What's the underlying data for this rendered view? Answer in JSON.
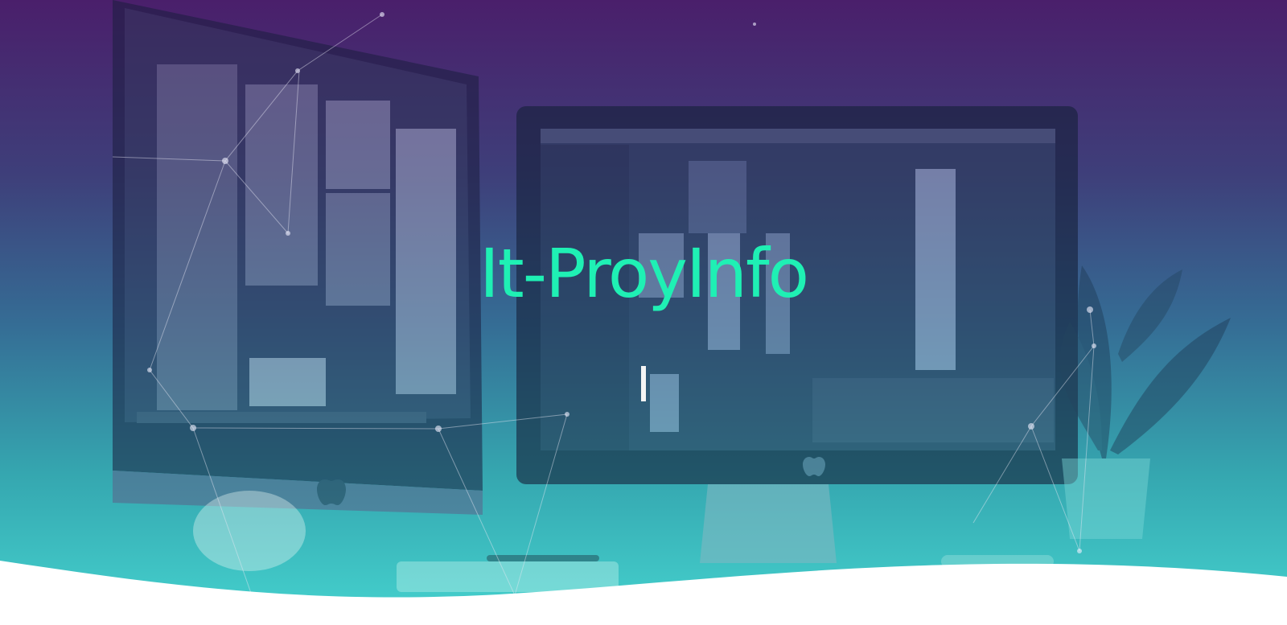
{
  "hero": {
    "title": "It-ProyInfo",
    "cursor": "|"
  },
  "colors": {
    "title": "#1ff0b4",
    "gradient_top": "#4a1f6b",
    "gradient_bottom": "#45d3cf",
    "wave": "#ffffff"
  },
  "icons": {
    "left_logo": "apple-logo-icon",
    "right_logo": "apple-logo-icon"
  }
}
